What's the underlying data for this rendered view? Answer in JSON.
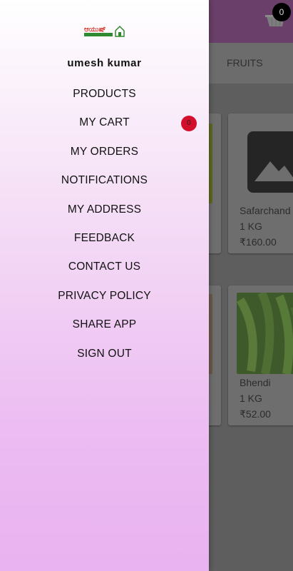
{
  "app": {
    "cart_count": "0",
    "tabs": [
      {
        "label": "FRUITS"
      }
    ],
    "products": [
      {
        "name": "Safarchand",
        "unit": "1 KG",
        "price": "₹160.00"
      },
      {
        "name": "Bhendi",
        "unit": "1 KG",
        "price": "₹52.00"
      }
    ]
  },
  "drawer": {
    "logo_text": "ಆಯುಷ್",
    "user_name": "umesh kumar",
    "menu": [
      {
        "label": "PRODUCTS"
      },
      {
        "label": "MY CART",
        "badge": "0"
      },
      {
        "label": "MY ORDERS"
      },
      {
        "label": "NOTIFICATIONS"
      },
      {
        "label": "MY ADDRESS"
      },
      {
        "label": "FEEDBACK"
      },
      {
        "label": "CONTACT US"
      },
      {
        "label": "PRIVACY POLICY"
      },
      {
        "label": "SHARE APP"
      },
      {
        "label": "SIGN OUT"
      }
    ]
  },
  "colors": {
    "badge": "#d40f2c",
    "drawer_top": "#ffffff",
    "drawer_bottom": "#e9b2f0",
    "appbar": "#6a3f69"
  }
}
